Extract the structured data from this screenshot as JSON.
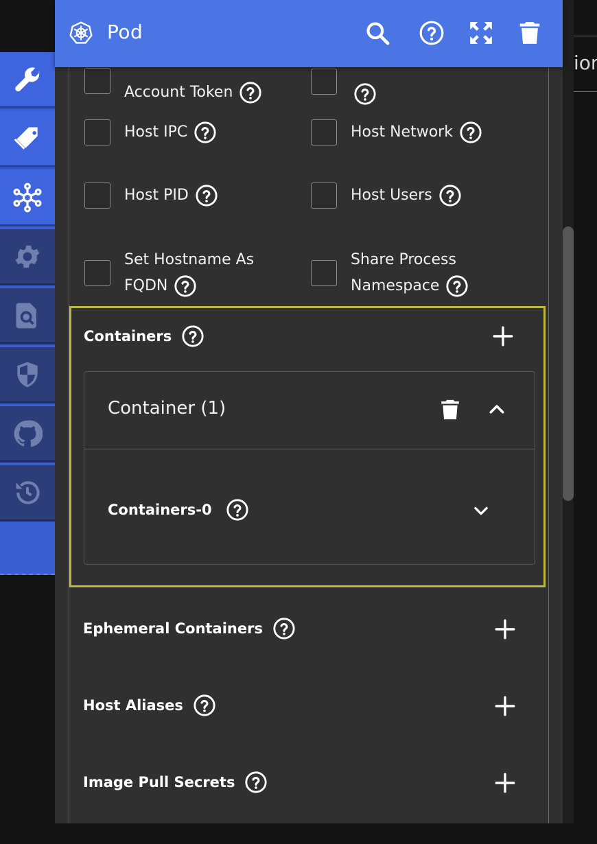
{
  "background": {
    "fragment_text": "ion"
  },
  "sidebar": {
    "items": [
      {
        "icon": "wrench-icon",
        "state": "active"
      },
      {
        "icon": "tags-icon",
        "state": "active"
      },
      {
        "icon": "network-icon",
        "state": "active"
      },
      {
        "icon": "gear-icon",
        "state": "inactive"
      },
      {
        "icon": "search-file-icon",
        "state": "inactive"
      },
      {
        "icon": "shield-icon",
        "state": "inactive"
      },
      {
        "icon": "github-icon",
        "state": "inactive"
      },
      {
        "icon": "history-icon",
        "state": "inactive"
      }
    ]
  },
  "header": {
    "title": "Pod",
    "logo_icon": "kubernetes-icon",
    "buttons": [
      "search-icon",
      "help-icon",
      "fullscreen-icon",
      "delete-icon"
    ]
  },
  "checkboxes": {
    "account_token": "Account Token",
    "host_ipc": "Host IPC",
    "host_network": "Host Network",
    "host_pid": "Host PID",
    "host_users": "Host Users",
    "set_hostname_line1": "Set Hostname As",
    "set_hostname_line2": "FQDN",
    "share_process_line1": "Share Process",
    "share_process_line2": "Namespace"
  },
  "containers": {
    "title": "Containers",
    "card_title": "Container (1)",
    "item_title": "Containers-0"
  },
  "sections": {
    "ephemeral": "Ephemeral Containers",
    "host_aliases": "Host Aliases",
    "image_pull_secrets": "Image Pull Secrets"
  },
  "colors": {
    "accent": "#4b74e4",
    "highlight_border": "#bdb83a",
    "panel_bg": "#303030"
  }
}
